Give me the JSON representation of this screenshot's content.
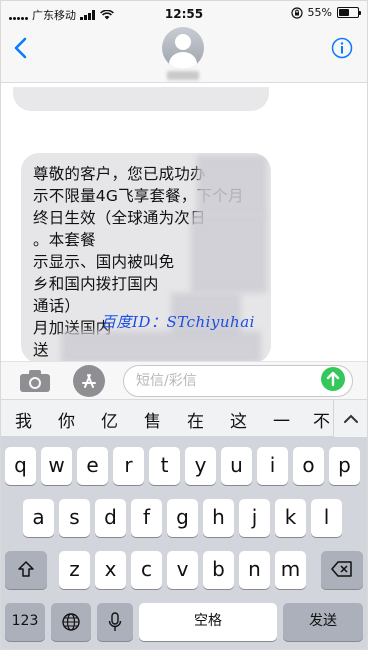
{
  "status_bar": {
    "carrier": "广东移动",
    "time": "12:55",
    "battery": "55%",
    "battery_level": 0.55
  },
  "header": {
    "contact_name": "10086",
    "back_icon": "chevron-left-icon",
    "info_icon": "info-icon"
  },
  "message": {
    "text": "尊敬的客户，您已成功办\n示不限量4G飞享套餐，下个月\n终日生效（全球通为次日\n。本套餐\n示显示、国内被叫免\n乡和国内拨打国内\n通话）\n月加送国内\n送\n）超出会\n",
    "watermark": "百度ID：STchiyuhai"
  },
  "compose": {
    "placeholder": "短信/彩信",
    "camera_icon": "camera-icon",
    "apps_icon": "app-store-icon",
    "send_icon": "send-arrow-icon"
  },
  "candidates": [
    "我",
    "你",
    "亿",
    "售",
    "在",
    "这",
    "一",
    "不"
  ],
  "keyboard": {
    "row1": [
      "q",
      "w",
      "e",
      "r",
      "t",
      "y",
      "u",
      "i",
      "o",
      "p"
    ],
    "row2": [
      "a",
      "s",
      "d",
      "f",
      "g",
      "h",
      "j",
      "k",
      "l"
    ],
    "row3": [
      "z",
      "x",
      "c",
      "v",
      "b",
      "n",
      "m"
    ],
    "numbers_label": "123",
    "space_label": "空格",
    "return_label": "发送"
  },
  "colors": {
    "ios_blue": "#0a7aff",
    "send_green": "#34c759",
    "watermark_blue": "#1a4fe0"
  }
}
